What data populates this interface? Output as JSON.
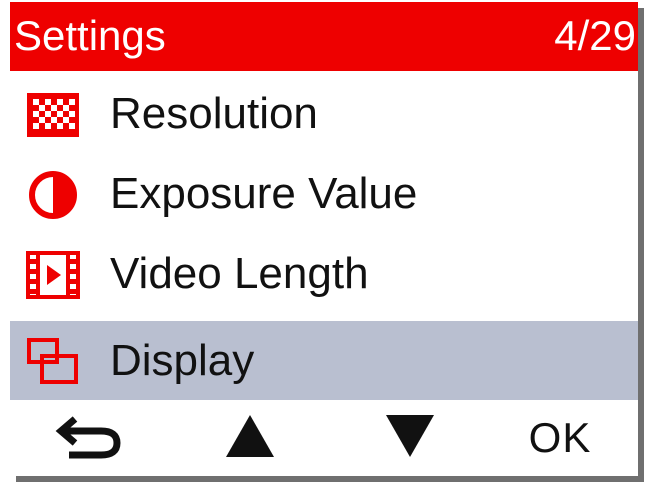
{
  "header": {
    "title": "Settings",
    "page_counter": "4/29"
  },
  "menu": {
    "items": [
      {
        "label": "Resolution",
        "icon": "resolution-checker-icon",
        "selected": false
      },
      {
        "label": "Exposure Value",
        "icon": "exposure-half-circle-icon",
        "selected": false
      },
      {
        "label": "Video Length",
        "icon": "video-film-play-icon",
        "selected": false
      },
      {
        "label": "Display",
        "icon": "display-screens-icon",
        "selected": true
      }
    ]
  },
  "footer": {
    "buttons": [
      {
        "label": "",
        "icon": "back-arrow-icon"
      },
      {
        "label": "",
        "icon": "up-triangle-icon"
      },
      {
        "label": "",
        "icon": "down-triangle-icon"
      },
      {
        "label": "OK",
        "icon": ""
      }
    ]
  },
  "colors": {
    "accent_red": "#ee0000",
    "selected_row": "#b9bfd0",
    "text": "#111111",
    "background": "#ffffff"
  }
}
